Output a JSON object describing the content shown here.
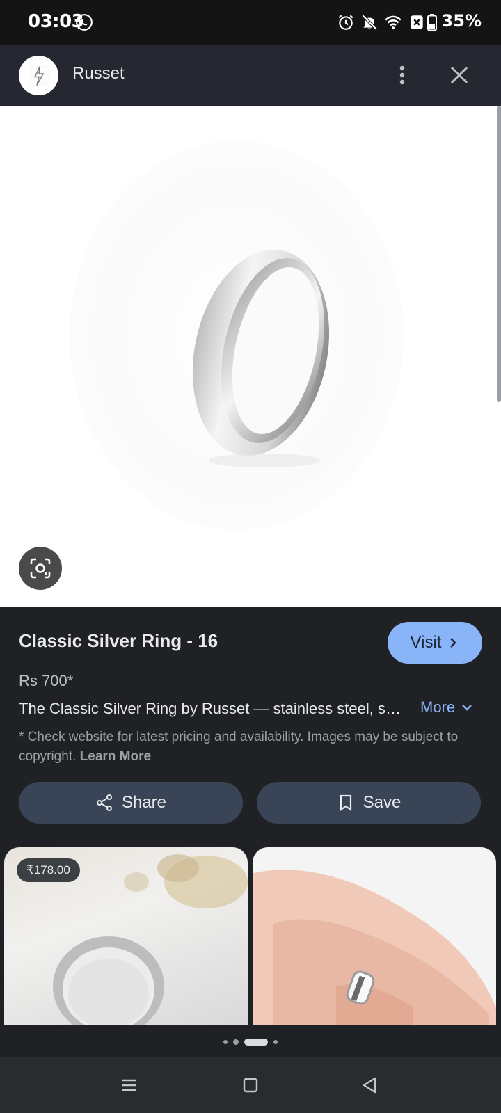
{
  "status_bar": {
    "time": "03:03",
    "battery": "35%",
    "icons": [
      "whatsapp-icon",
      "alarm-icon",
      "bell-off-icon",
      "wifi-icon",
      "battery-icon"
    ]
  },
  "app_bar": {
    "site_name": "Russet",
    "icons": [
      "more-vert-icon",
      "close-icon"
    ]
  },
  "product": {
    "title": "Classic Silver Ring - 16",
    "visit_label": "Visit",
    "price": "Rs 700*",
    "description": "The Classic Silver Ring by Russet — stainless steel, smooth polished finish, everyday comfort fit.",
    "more_label": "More",
    "disclaimer": "* Check website for latest pricing and availability. Images may be subject to copyright.",
    "learn_more_label": "Learn More"
  },
  "actions": {
    "share_label": "Share",
    "save_label": "Save"
  },
  "related": {
    "items": [
      {
        "price_badge": "₹178.00"
      },
      {
        "price_badge": ""
      }
    ]
  },
  "carousel": {
    "total": 4,
    "active_index": 2
  },
  "colors": {
    "accent": "#8ab4f8",
    "panel": "#202124",
    "button": "#394457"
  }
}
